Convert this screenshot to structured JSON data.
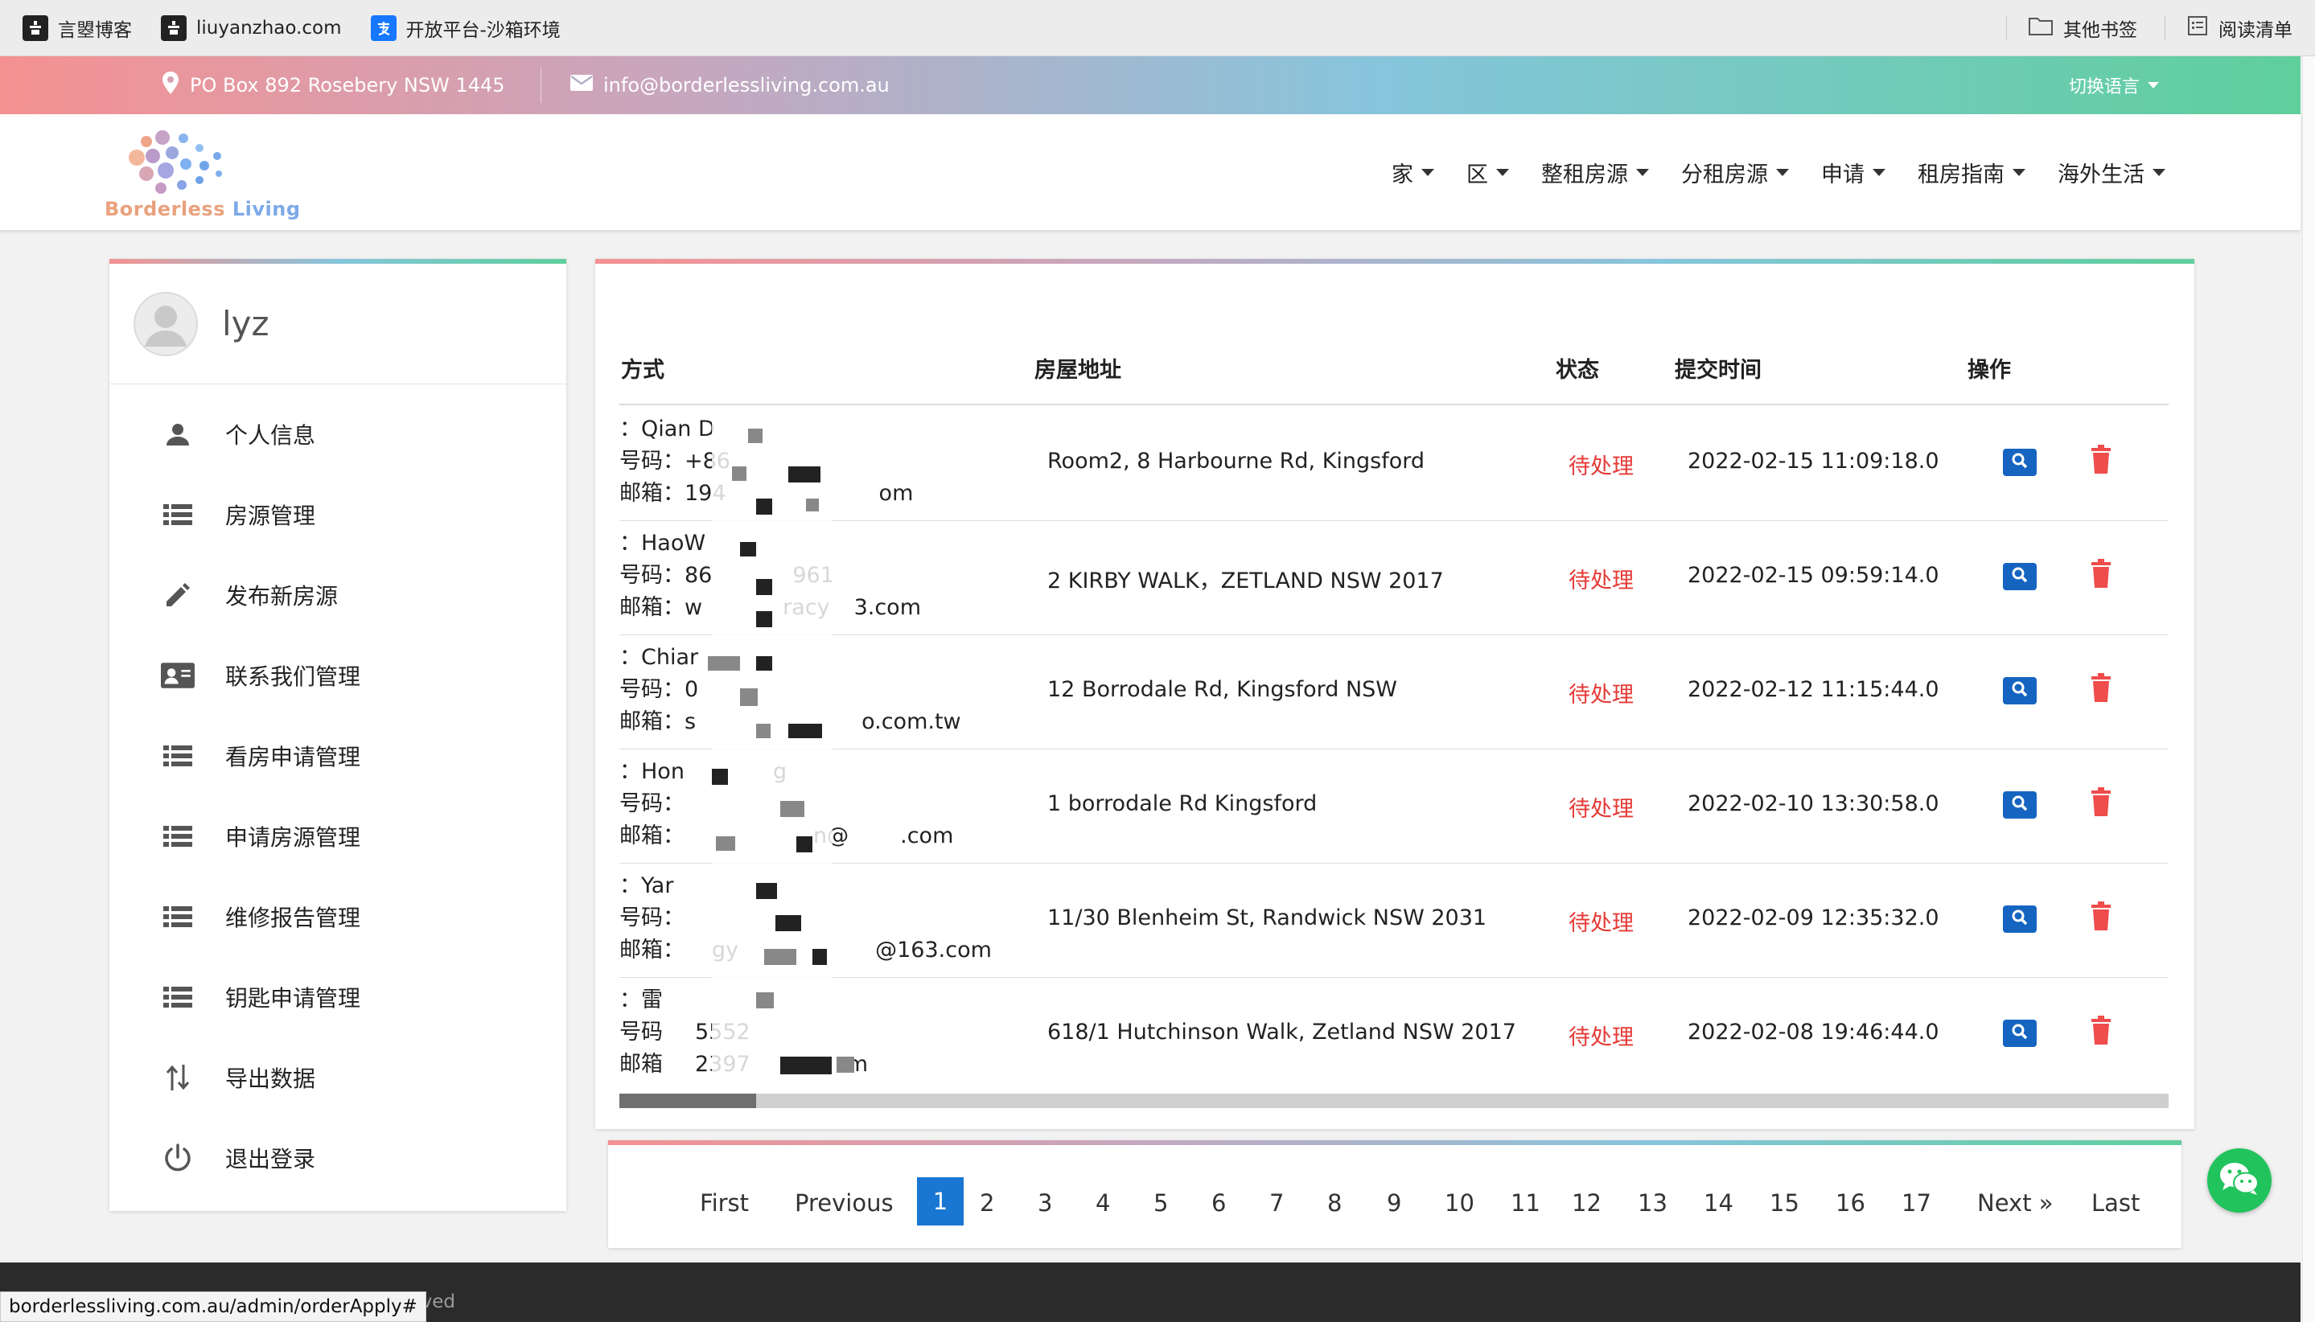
{
  "browser": {
    "bookmarks": [
      "言曌博客",
      "liuyanzhao.com",
      "开放平台-沙箱环境"
    ],
    "right_bookmarks": [
      "其他书签",
      "阅读清单"
    ],
    "status_url": "borderlessliving.com.au/admin/orderApply#"
  },
  "topbar": {
    "address": "PO Box 892 Rosebery NSW 1445",
    "email": "info@borderlessliving.com.au",
    "language": "切换语言"
  },
  "brand": {
    "part1": "Borderless ",
    "part2": "Living"
  },
  "nav": [
    "家",
    "区",
    "整租房源",
    "分租房源",
    "申请",
    "租房指南",
    "海外生活"
  ],
  "user": {
    "name": "lyz"
  },
  "sidebar": [
    {
      "label": "个人信息",
      "icon": "person-icon"
    },
    {
      "label": "房源管理",
      "icon": "list-icon"
    },
    {
      "label": "发布新房源",
      "icon": "pencil-icon"
    },
    {
      "label": "联系我们管理",
      "icon": "contact-card-icon"
    },
    {
      "label": "看房申请管理",
      "icon": "list-icon"
    },
    {
      "label": "申请房源管理",
      "icon": "list-icon"
    },
    {
      "label": "维修报告管理",
      "icon": "list-icon"
    },
    {
      "label": "钥匙申请管理",
      "icon": "list-icon"
    },
    {
      "label": "导出数据",
      "icon": "sort-arrows-icon"
    },
    {
      "label": "退出登录",
      "icon": "power-icon"
    }
  ],
  "table": {
    "columns": [
      "方式",
      "房屋地址",
      "状态",
      "提交时间",
      "操作"
    ],
    "rows": [
      {
        "l1": "：Qian D",
        "l2": "号码：+86",
        "l3": "邮箱：194",
        "l3b": "om",
        "address": "Room2, 8 Harbourne Rd, Kingsford",
        "status": "待处理",
        "time": "2022-02-15 11:09:18.0"
      },
      {
        "l1": "：HaoW",
        "l2": "号码：86",
        "l2b": "961",
        "l3": "邮箱：w",
        "l3b": "racy",
        "l3c": "3.com",
        "address": "2 KIRBY WALK，ZETLAND NSW 2017",
        "status": "待处理",
        "time": "2022-02-15 09:59:14.0"
      },
      {
        "l1": "：Chiar",
        "l2": "号码：0",
        "l3": "邮箱：s",
        "l3b": "o.com.tw",
        "address": "12 Borrodale Rd, Kingsford NSW",
        "status": "待处理",
        "time": "2022-02-12 11:15:44.0"
      },
      {
        "l1": "：Hon",
        "l1b": "g",
        "l2": "号码：",
        "l3": "邮箱：",
        "l3b": "n@",
        "l3c": ".com",
        "address": "1 borrodale Rd Kingsford",
        "status": "待处理",
        "time": "2022-02-10 13:30:58.0"
      },
      {
        "l1": "：Yar",
        "l2": "号码：",
        "l3": "邮箱：",
        "l3b": "gy",
        "l3c": "@163.com",
        "address": "11/30 Blenheim St, Randwick NSW 2031",
        "status": "待处理",
        "time": "2022-02-09 12:35:32.0"
      },
      {
        "l1": "：雷",
        "l2": "号码",
        "l2b": "5552",
        "l3": "邮箱",
        "l3b": "2397",
        "l3c": "m",
        "address": "618/1 Hutchinson Walk, Zetland NSW 2017",
        "status": "待处理",
        "time": "2022-02-08 19:46:44.0"
      }
    ]
  },
  "pagination": {
    "first": "First",
    "previous": "Previous",
    "pages": [
      "1",
      "2",
      "3",
      "4",
      "5",
      "6",
      "7",
      "8",
      "9",
      "10",
      "11",
      "12",
      "13",
      "14",
      "15",
      "16",
      "17"
    ],
    "current": "1",
    "next": "Next »",
    "last": "Last"
  },
  "footer": {
    "text": "erved"
  },
  "colors": {
    "pending": "#e53935",
    "accent": "#1976d2",
    "chat": "#21c35d"
  }
}
